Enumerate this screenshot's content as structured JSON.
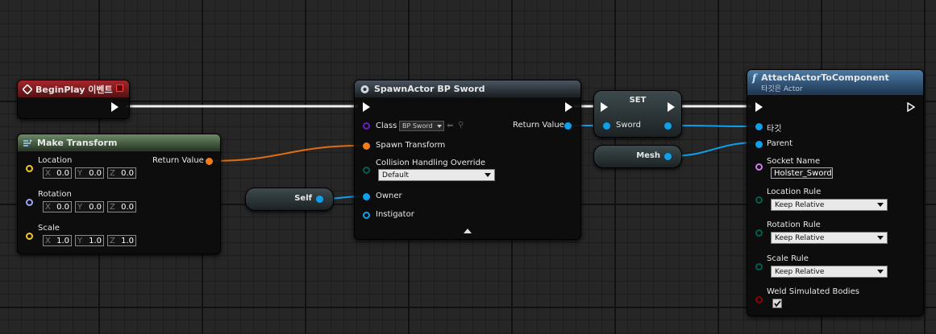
{
  "colors": {
    "exec": "#ffffff",
    "object": "#0fa0ec",
    "transform": "#f07c1a",
    "class": "#6a1ec6",
    "string": "#d47cf0",
    "byte": "#005f4f",
    "bool": "#920101",
    "vector": "#f6c624",
    "rotator": "#9aa7f6"
  },
  "begin_play": {
    "title": "BeginPlay 이벤트",
    "icon": "event-diamond-icon"
  },
  "make_transform": {
    "title": "Make Transform",
    "icon": "function-icon",
    "location_label": "Location",
    "rotation_label": "Rotation",
    "scale_label": "Scale",
    "return_label": "Return Value",
    "axis": {
      "x": "X",
      "y": "Y",
      "z": "Z"
    },
    "location": {
      "x": "0.0",
      "y": "0.0",
      "z": "0.0"
    },
    "rotation": {
      "x": "0.0",
      "y": "0.0",
      "z": "0.0"
    },
    "scale": {
      "x": "1.0",
      "y": "1.0",
      "z": "1.0"
    }
  },
  "self_node": {
    "label": "Self"
  },
  "spawn": {
    "title": "SpawnActor BP Sword",
    "icon": "spawn-icon",
    "class_label": "Class",
    "class_value": "BP Sword",
    "spawn_transform_label": "Spawn Transform",
    "collision_label": "Collision Handling Override",
    "collision_value": "Default",
    "owner_label": "Owner",
    "instigator_label": "Instigator",
    "return_label": "Return Value"
  },
  "set_node": {
    "title": "SET",
    "var_label": "Sword"
  },
  "mesh_node": {
    "label": "Mesh"
  },
  "attach": {
    "title": "AttachActorToComponent",
    "subtitle": "타깃은 Actor",
    "icon_glyph": "f",
    "target_label": "타깃",
    "parent_label": "Parent",
    "socket_label": "Socket Name",
    "socket_value": "Holster_Sword",
    "location_rule_label": "Location Rule",
    "location_rule_value": "Keep Relative",
    "rotation_rule_label": "Rotation Rule",
    "rotation_rule_value": "Keep Relative",
    "scale_rule_label": "Scale Rule",
    "scale_rule_value": "Keep Relative",
    "weld_label": "Weld Simulated Bodies",
    "weld_checked": true
  }
}
